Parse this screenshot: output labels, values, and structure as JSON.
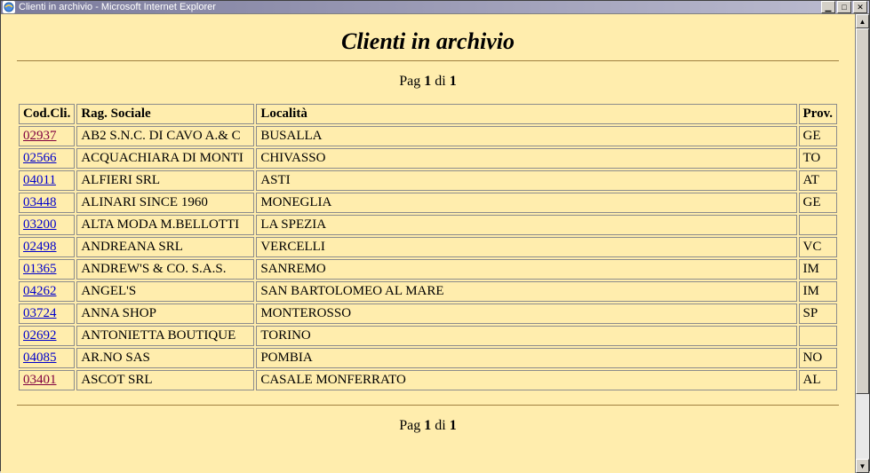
{
  "window": {
    "title": "Clienti in archivio - Microsoft Internet Explorer"
  },
  "page": {
    "title": "Clienti in archivio",
    "pager_prefix": "Pag ",
    "pager_page": "1",
    "pager_mid": " di ",
    "pager_total": "1"
  },
  "table": {
    "headers": {
      "cod": "Cod.Cli.",
      "rag": "Rag. Sociale",
      "loc": "Località",
      "prov": "Prov."
    },
    "rows": [
      {
        "cod": "02937",
        "visited": true,
        "rag": "AB2 S.N.C. DI CAVO A.& C",
        "loc": "BUSALLA",
        "prov": "GE"
      },
      {
        "cod": "02566",
        "visited": false,
        "rag": "ACQUACHIARA DI MONTI",
        "loc": "CHIVASSO",
        "prov": "TO"
      },
      {
        "cod": "04011",
        "visited": false,
        "rag": "ALFIERI SRL",
        "loc": "ASTI",
        "prov": "AT"
      },
      {
        "cod": "03448",
        "visited": false,
        "rag": "ALINARI SINCE 1960",
        "loc": "MONEGLIA",
        "prov": "GE"
      },
      {
        "cod": "03200",
        "visited": false,
        "rag": "ALTA MODA M.BELLOTTI",
        "loc": "LA SPEZIA",
        "prov": ""
      },
      {
        "cod": "02498",
        "visited": false,
        "rag": "ANDREANA SRL",
        "loc": "VERCELLI",
        "prov": "VC"
      },
      {
        "cod": "01365",
        "visited": false,
        "rag": "ANDREW'S & CO. S.A.S.",
        "loc": "SANREMO",
        "prov": "IM"
      },
      {
        "cod": "04262",
        "visited": false,
        "rag": "ANGEL'S",
        "loc": "SAN BARTOLOMEO AL MARE",
        "prov": "IM"
      },
      {
        "cod": "03724",
        "visited": false,
        "rag": "ANNA SHOP",
        "loc": "MONTEROSSO",
        "prov": "SP"
      },
      {
        "cod": "02692",
        "visited": false,
        "rag": "ANTONIETTA BOUTIQUE",
        "loc": "TORINO",
        "prov": ""
      },
      {
        "cod": "04085",
        "visited": false,
        "rag": "AR.NO SAS",
        "loc": "POMBIA",
        "prov": "NO"
      },
      {
        "cod": "03401",
        "visited": true,
        "rag": "ASCOT SRL",
        "loc": "CASALE MONFERRATO",
        "prov": "AL"
      }
    ]
  }
}
